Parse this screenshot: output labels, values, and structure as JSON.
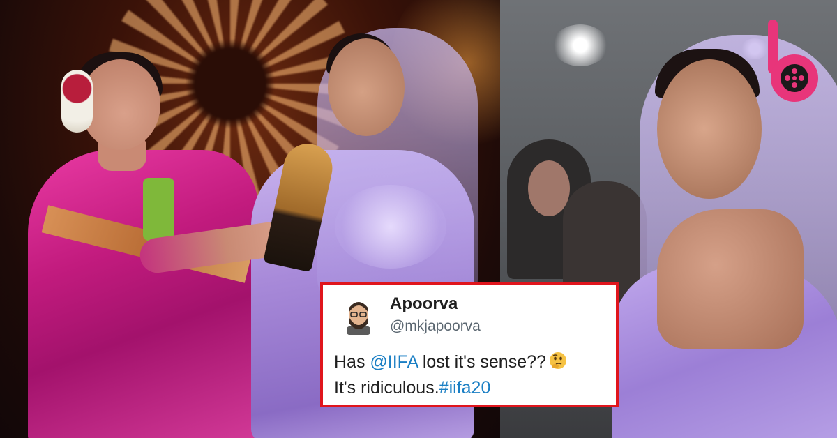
{
  "tweet": {
    "name": "Apoorva",
    "handle": "@mkjapoorva",
    "line1_prefix": "Has ",
    "line1_mention": "@IIFA",
    "line1_suffix": " lost it's sense??",
    "line1_emoji": "thinking-face-icon",
    "line2_prefix": "It's ridiculous.",
    "line2_hashtag": "#iifa20"
  },
  "colors": {
    "card_border": "#e0151d",
    "link": "#1b7fc4",
    "logo_pink": "#e8357a"
  },
  "logo": {
    "icon": "film-reel-b-logo-icon"
  }
}
